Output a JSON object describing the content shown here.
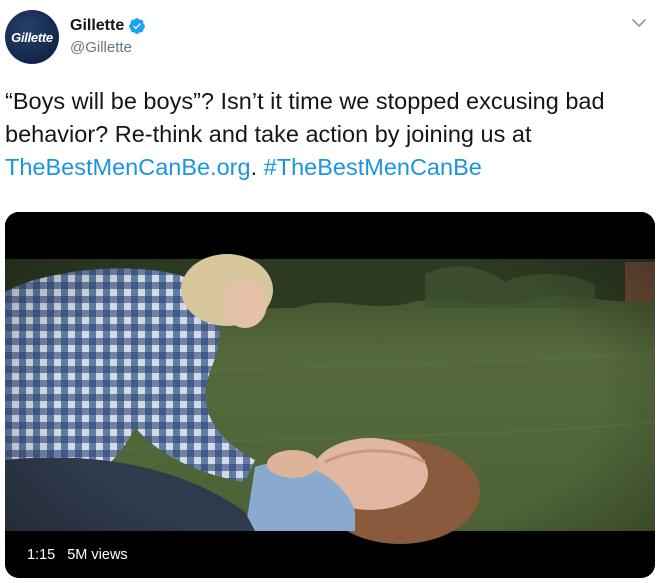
{
  "author": {
    "avatar_logo_text": "Gillette",
    "display_name": "Gillette",
    "handle": "@Gillette",
    "verified": true
  },
  "tweet": {
    "text_part1": "“Boys will be boys”? Isn’t it time we stopped excusing bad behavior? Re-think and take action by joining us at ",
    "link_url_text": "TheBestMenCanBe.org",
    "text_part2": ". ",
    "hashtag": "#TheBestMenCanBe"
  },
  "media": {
    "duration": "1:15",
    "views": "5M views"
  },
  "colors": {
    "link": "#1b95e0",
    "verified": "#1da1f2",
    "text": "#14171a",
    "secondary": "#657786"
  },
  "icons": {
    "verified": "verified-badge-icon",
    "menu": "chevron-down-icon"
  }
}
